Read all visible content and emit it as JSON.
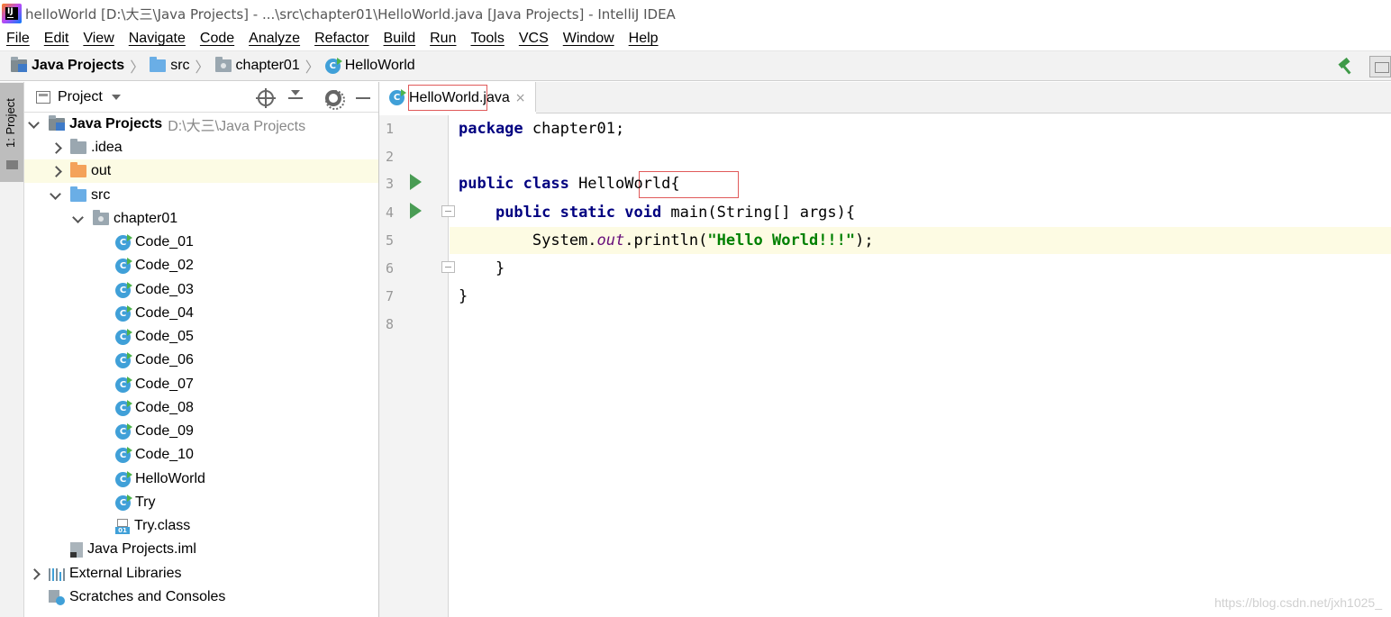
{
  "window": {
    "title": "helloWorld [D:\\大三\\Java Projects] - ...\\src\\chapter01\\HelloWorld.java [Java Projects] - IntelliJ IDEA",
    "logo_text": "IJ"
  },
  "menu": [
    "File",
    "Edit",
    "View",
    "Navigate",
    "Code",
    "Analyze",
    "Refactor",
    "Build",
    "Run",
    "Tools",
    "VCS",
    "Window",
    "Help"
  ],
  "breadcrumb": {
    "project": "Java Projects",
    "src": "src",
    "package": "chapter01",
    "file": "HelloWorld",
    "separator": "〉"
  },
  "stripe": {
    "label": "1: Project"
  },
  "project_panel": {
    "title": "Project",
    "tree": [
      {
        "label": "Java Projects",
        "hint": "D:\\大三\\Java Projects",
        "icon": "project-folder-icon",
        "level": 0,
        "arrow": "open",
        "bold": true
      },
      {
        "label": ".idea",
        "icon": "folder-icon",
        "level": 1,
        "arrow": "closed"
      },
      {
        "label": "out",
        "icon": "excluded-folder-icon",
        "level": 1,
        "arrow": "closed",
        "highlighted": true
      },
      {
        "label": "src",
        "icon": "source-folder-icon",
        "level": 1,
        "arrow": "open"
      },
      {
        "label": "chapter01",
        "icon": "package-icon",
        "level": 2,
        "arrow": "open"
      },
      {
        "label": "Code_01",
        "icon": "class-icon",
        "level": 3
      },
      {
        "label": "Code_02",
        "icon": "class-icon",
        "level": 3
      },
      {
        "label": "Code_03",
        "icon": "class-icon",
        "level": 3
      },
      {
        "label": "Code_04",
        "icon": "class-icon",
        "level": 3
      },
      {
        "label": "Code_05",
        "icon": "class-icon",
        "level": 3
      },
      {
        "label": "Code_06",
        "icon": "class-icon",
        "level": 3
      },
      {
        "label": "Code_07",
        "icon": "class-icon",
        "level": 3
      },
      {
        "label": "Code_08",
        "icon": "class-icon",
        "level": 3
      },
      {
        "label": "Code_09",
        "icon": "class-icon",
        "level": 3
      },
      {
        "label": "Code_10",
        "icon": "class-icon",
        "level": 3
      },
      {
        "label": "HelloWorld",
        "icon": "class-icon",
        "level": 3
      },
      {
        "label": "Try",
        "icon": "class-icon",
        "level": 3
      },
      {
        "label": "Try.class",
        "icon": "class-file-icon",
        "level": 3
      },
      {
        "label": "Java Projects.iml",
        "icon": "iml-file-icon",
        "level": 1
      },
      {
        "label": "External Libraries",
        "icon": "library-icon",
        "level": 0,
        "arrow": "closed"
      },
      {
        "label": "Scratches and Consoles",
        "icon": "scratches-icon",
        "level": 0
      }
    ]
  },
  "editor": {
    "tab": {
      "label": "HelloWorld.java",
      "close": "×"
    },
    "lines": [
      {
        "no": "1",
        "tokens": [
          {
            "t": "package",
            "c": "kw"
          },
          {
            "t": " chapter01;",
            "c": ""
          }
        ]
      },
      {
        "no": "2",
        "tokens": []
      },
      {
        "no": "3",
        "tokens": [
          {
            "t": "public class",
            "c": "kw"
          },
          {
            "t": " HelloWorld{",
            "c": ""
          }
        ],
        "run": true
      },
      {
        "no": "4",
        "tokens": [
          {
            "t": "    ",
            "c": ""
          },
          {
            "t": "public static void",
            "c": "kw"
          },
          {
            "t": " main(String[] args){",
            "c": ""
          }
        ],
        "run": true,
        "fold": true
      },
      {
        "no": "5",
        "tokens": [
          {
            "t": "        System.",
            "c": ""
          },
          {
            "t": "out",
            "c": "fld"
          },
          {
            "t": ".println(",
            "c": ""
          },
          {
            "t": "\"Hello World!!!\"",
            "c": "str"
          },
          {
            "t": ");",
            "c": ""
          }
        ],
        "current": true
      },
      {
        "no": "6",
        "tokens": [
          {
            "t": "    }",
            "c": ""
          }
        ],
        "fold": true
      },
      {
        "no": "7",
        "tokens": [
          {
            "t": "}",
            "c": ""
          }
        ]
      },
      {
        "no": "8",
        "tokens": []
      }
    ]
  },
  "watermark": "https://blog.csdn.net/jxh1025_",
  "colors": {
    "keyword": "#000080",
    "string": "#008000",
    "field": "#660e7a",
    "run_icon": "#499c54",
    "highlight_box": "#e05a5a",
    "current_line": "#fdfbe3"
  }
}
